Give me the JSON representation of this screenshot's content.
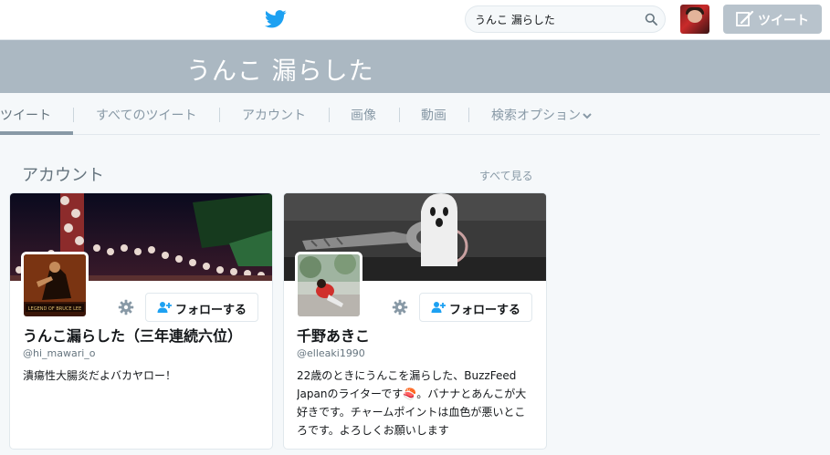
{
  "search": {
    "value": "うんこ 漏らした"
  },
  "header": {
    "tweet_label": "ツイート"
  },
  "banner": {
    "query": "うんこ 漏らした"
  },
  "tabs": [
    {
      "label": "ツイート",
      "active": true
    },
    {
      "label": "すべてのツイート"
    },
    {
      "label": "アカウント"
    },
    {
      "label": "画像"
    },
    {
      "label": "動画"
    },
    {
      "label": "検索オプション"
    }
  ],
  "section": {
    "title": "アカウント",
    "see_all": "すべて見る"
  },
  "cards": [
    {
      "name": "うんこ漏らした（三年連続六位）",
      "handle": "@hi_mawari_o",
      "bio": "潰瘍性大腸炎だよバカヤロー！",
      "follow_label": "フォローする",
      "pfp_caption": "LEGEND OF BRUCE LEE"
    },
    {
      "name": "千野あきこ",
      "handle": "@elleaki1990",
      "bio": "22歳のときにうんこを漏らした、BuzzFeed Japanのライターです🍣。バナナとあんこが大好きです。チャームポイントは血色が悪いところです。よろしくお願いします",
      "follow_label": "フォローする"
    }
  ],
  "colors": {
    "accent": "#1da1f2",
    "banner": "#abb8c2",
    "muted": "#8899a6"
  }
}
